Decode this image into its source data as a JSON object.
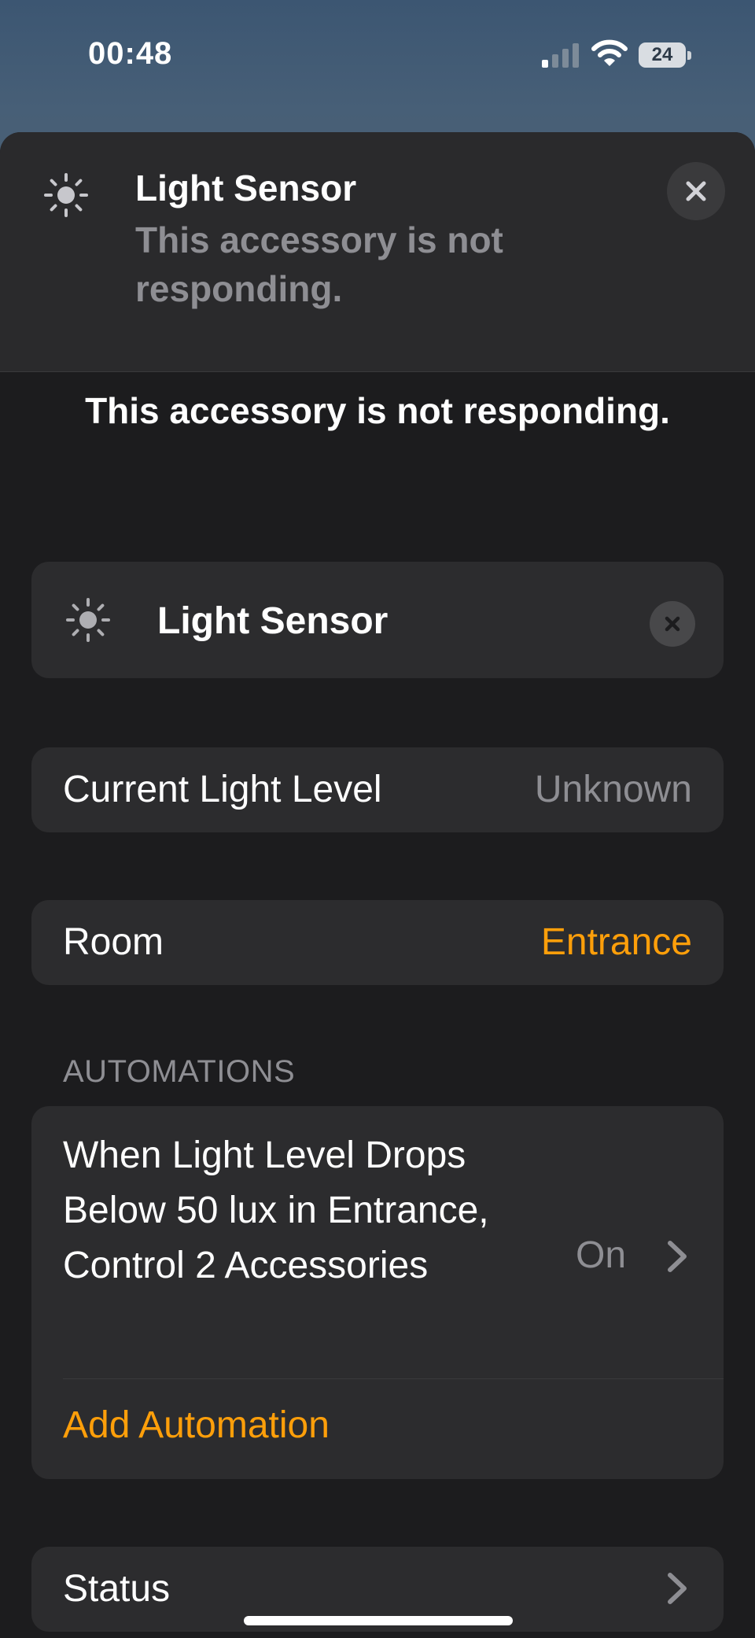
{
  "status_bar": {
    "time": "00:48",
    "battery": "24"
  },
  "banner": {
    "title": "Light Sensor",
    "subtitle": "This accessory is not responding."
  },
  "notice": "This accessory is not responding.",
  "accessory": {
    "name": "Light Sensor"
  },
  "current_light_level": {
    "label": "Current Light Level",
    "value": "Unknown"
  },
  "room": {
    "label": "Room",
    "value": "Entrance"
  },
  "automations": {
    "header": "AUTOMATIONS",
    "items": [
      {
        "description": "When Light Level Drops Below 50 lux in Entrance, Control 2 Accessories",
        "state": "On"
      }
    ],
    "add_label": "Add Automation"
  },
  "status": {
    "label": "Status"
  },
  "colors": {
    "accent": "#ff9f0a",
    "secondary_text": "#8e8e93",
    "card": "#2c2c2e",
    "background": "#1c1c1e"
  }
}
